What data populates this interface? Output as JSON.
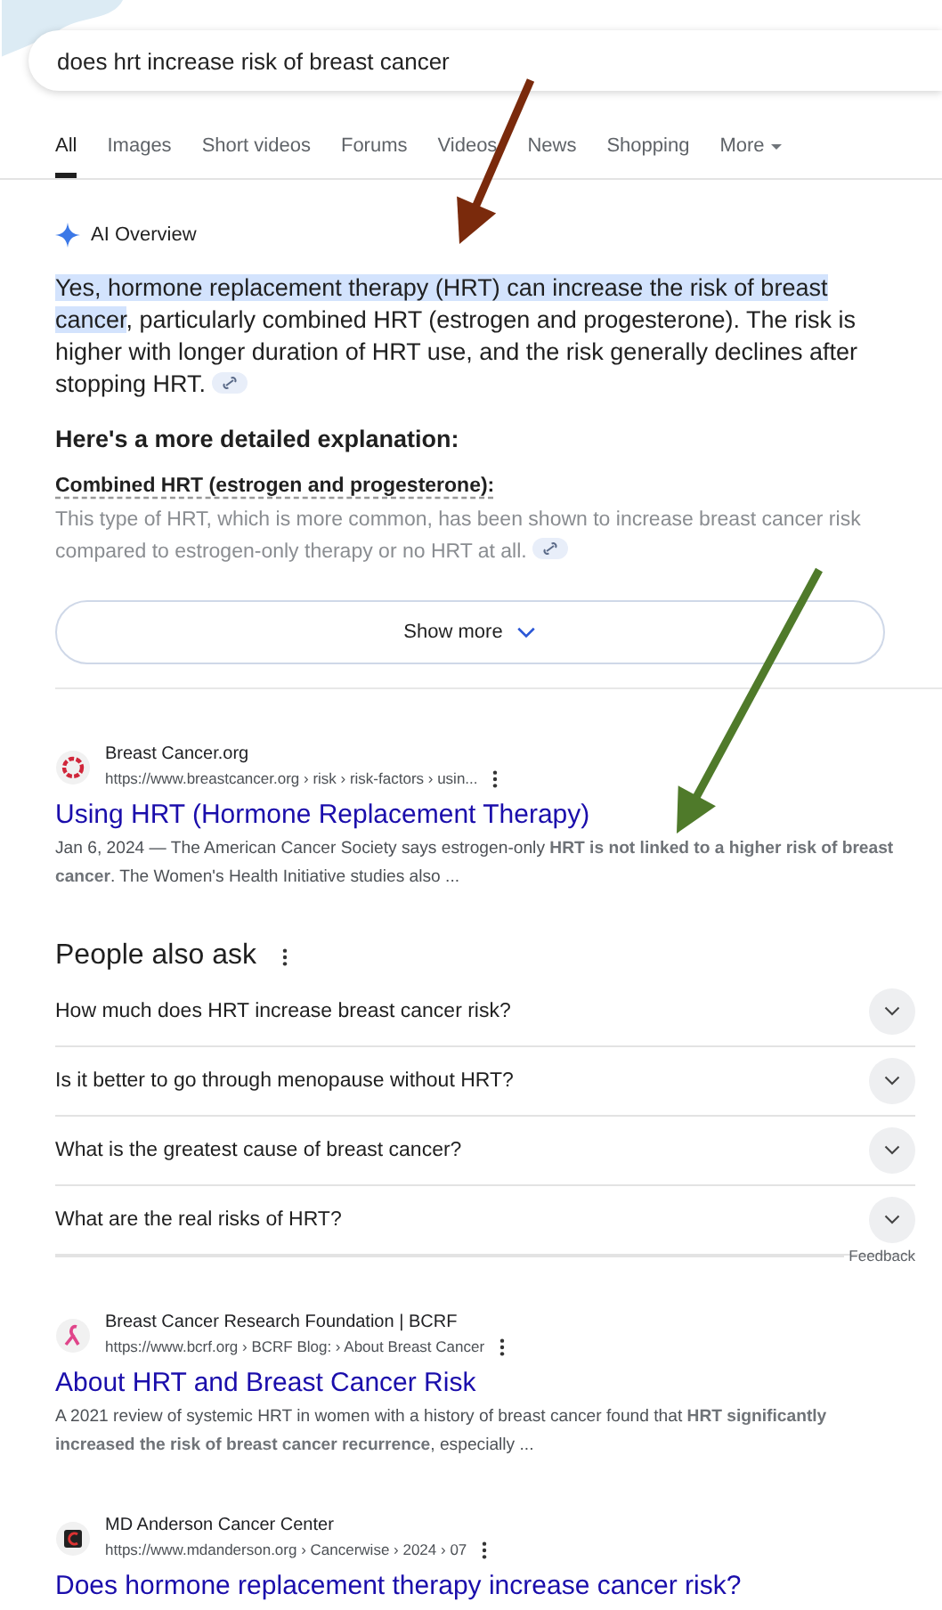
{
  "search": {
    "value": "does hrt increase risk of breast cancer"
  },
  "tabs": [
    {
      "label": "All",
      "selected": true,
      "kind": "tab"
    },
    {
      "label": "Images",
      "selected": false,
      "kind": "tab"
    },
    {
      "label": "Short videos",
      "selected": false,
      "kind": "tab"
    },
    {
      "label": "Forums",
      "selected": false,
      "kind": "tab"
    },
    {
      "label": "Videos",
      "selected": false,
      "kind": "tab"
    },
    {
      "label": "News",
      "selected": false,
      "kind": "tab"
    },
    {
      "label": "Shopping",
      "selected": false,
      "kind": "tab"
    },
    {
      "label": "More",
      "selected": false,
      "kind": "menu"
    }
  ],
  "ai_overview": {
    "title": "AI Overview",
    "answer_highlight": "Yes, hormone replacement therapy (HRT) can increase the risk of breast cancer",
    "answer_rest": ", particularly combined HRT (estrogen and progesterone). The risk is higher with longer duration of HRT use, and the risk generally declines after stopping HRT.",
    "subtitle": "Here's a more detailed explanation:",
    "sections": [
      {
        "heading": "Combined HRT (estrogen and progesterone):",
        "text": "This type of HRT, which is more common, has been shown to increase breast cancer risk compared to estrogen-only therapy or no HRT at all."
      }
    ],
    "show_more": "Show more"
  },
  "results": [
    {
      "site": "Breast Cancer.org",
      "url": "https://www.breastcancer.org › risk › risk-factors › usin...",
      "title": "Using HRT (Hormone Replacement Therapy)",
      "snippet": "Jan 6, 2024 — The American Cancer Society says estrogen-only **HRT is not linked to a higher risk of breast cancer**. The Women's Health Initiative studies also ...",
      "kind": "ring"
    }
  ],
  "people_also_ask": {
    "title": "People also ask",
    "questions": [
      {
        "text": "How much does HRT increase breast cancer risk?",
        "expanded": false
      },
      {
        "text": "Is it better to go through menopause without HRT?",
        "expanded": false
      },
      {
        "text": "What is the greatest cause of breast cancer?",
        "expanded": false
      },
      {
        "text": "What are the real risks of HRT?",
        "expanded": false
      }
    ],
    "feedback": "Feedback"
  },
  "more_results": [
    {
      "site": "Breast Cancer Research Foundation | BCRF",
      "url": "https://www.bcrf.org › BCRF Blog: › About Breast Cancer",
      "title": "About HRT and Breast Cancer Risk",
      "snippet": "A 2021 review of systemic HRT in women with a history of breast cancer found that **HRT significantly increased the risk of breast cancer recurrence**, especially ...",
      "kind": "ribbon"
    },
    {
      "site": "MD Anderson Cancer Center",
      "url": "https://www.mdanderson.org › Cancerwise › 2024 › 07",
      "title": "Does hormone replacement therapy increase cancer risk?",
      "kind": "square"
    }
  ],
  "annotations": [
    {
      "color": "#7a2a0c"
    },
    {
      "color": "#4f7a2a"
    }
  ]
}
